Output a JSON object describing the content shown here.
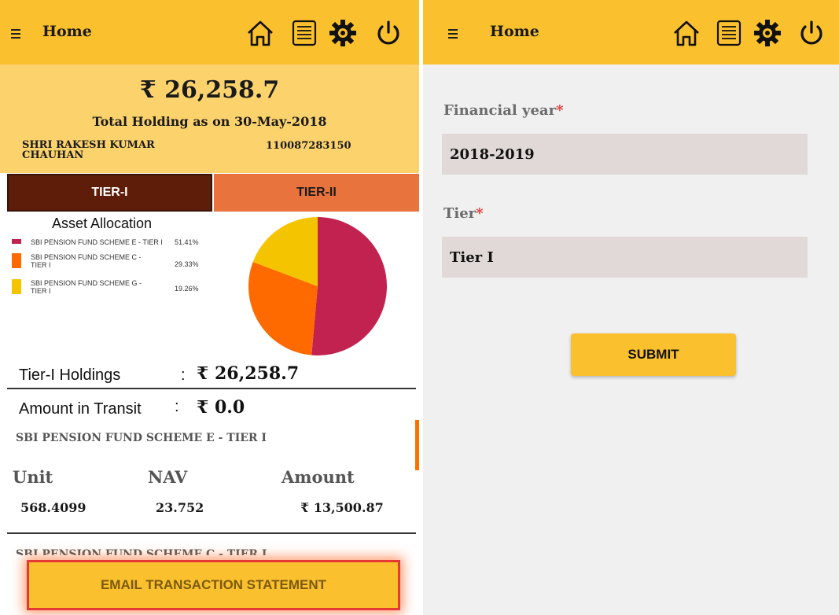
{
  "left": {
    "appbar": {
      "title": "Home"
    },
    "summary": {
      "total_amount": "₹ 26,258.7",
      "total_label": "Total Holding as on 30-May-2018",
      "name": "SHRI RAKESH KUMAR CHAUHAN",
      "pran": "110087283150"
    },
    "tabs": [
      {
        "label": "TIER-I",
        "selected": true
      },
      {
        "label": "TIER-II",
        "selected": false
      }
    ],
    "asset_allocation": {
      "title": "Asset Allocation",
      "legend": [
        {
          "name": "SBI PENSION FUND SCHEME E - TIER I",
          "pct": "51.41%",
          "color": "#c2224f"
        },
        {
          "name": "SBI PENSION FUND SCHEME C - TIER I",
          "pct": "29.33%",
          "color": "#ff6a00"
        },
        {
          "name": "SBI PENSION FUND SCHEME G - TIER I",
          "pct": "19.26%",
          "color": "#f5c400"
        }
      ]
    },
    "holdings": {
      "tier1_label": "Tier-I Holdings",
      "tier1_value": "₹ 26,258.7",
      "transit_label": "Amount in Transit",
      "transit_value": "₹ 0.0",
      "colon": ":"
    },
    "scheme": {
      "title": "SBI PENSION FUND SCHEME E - TIER I",
      "columns": [
        "Unit",
        "NAV",
        "Amount"
      ],
      "values": [
        "568.4099",
        "23.752",
        "₹ 13,500.87"
      ]
    },
    "scheme_next_title": "SBI PENSION FUND SCHEME C - TIER I",
    "email_button": "EMAIL TRANSACTION STATEMENT"
  },
  "right": {
    "appbar": {
      "title": "Home"
    },
    "financial_year_label": "Financial year",
    "financial_year_value": "2018-2019",
    "tier_label": "Tier",
    "tier_value": "Tier I",
    "required_mark": "*",
    "submit": "SUBMIT"
  },
  "icons": [
    "menu-icon",
    "home-icon",
    "document-icon",
    "settings-icon",
    "power-icon"
  ],
  "colors": {
    "appbar": "#fbc02d",
    "summary": "#fbd26c",
    "tab_selected": "#5e1d08",
    "tab_unselected": "#e8733c",
    "accent": "#ff6f00",
    "field": "#e0d9d7",
    "required": "#e53935"
  },
  "chart_data": {
    "type": "pie",
    "title": "Asset Allocation",
    "categories": [
      "SBI PENSION FUND SCHEME E - TIER I",
      "SBI PENSION FUND SCHEME C - TIER I",
      "SBI PENSION FUND SCHEME G - TIER I"
    ],
    "values": [
      51.41,
      29.33,
      19.26
    ],
    "colors": [
      "#c2224f",
      "#ff6a00",
      "#f5c400"
    ],
    "legend": "left"
  }
}
